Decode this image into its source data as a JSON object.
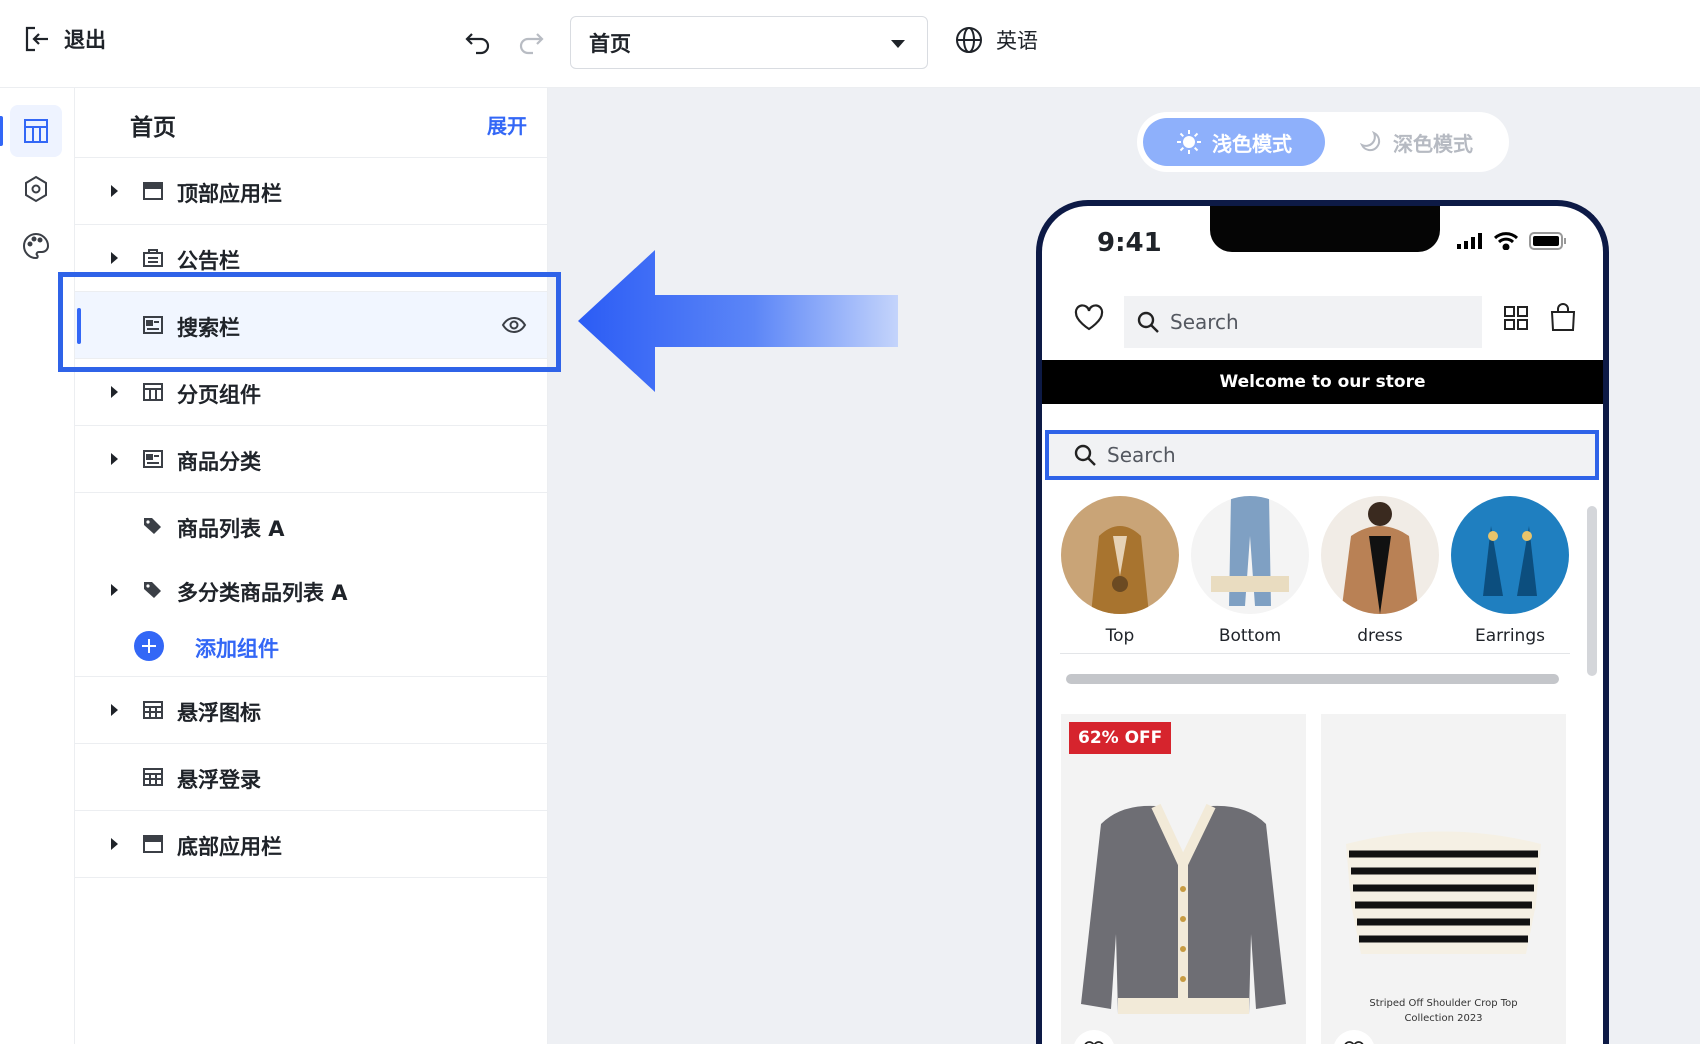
{
  "topbar": {
    "exit_label": "退出",
    "page_select_value": "首页",
    "language_label": "英语"
  },
  "rail": {
    "items": [
      "layout-icon",
      "settings-hex-icon",
      "palette-icon"
    ]
  },
  "tree": {
    "title": "首页",
    "expand_label": "展开",
    "items": [
      {
        "label": "顶部应用栏",
        "icon": "top-bar-icon",
        "expandable": true
      },
      {
        "label": "公告栏",
        "icon": "announcement-icon",
        "expandable": true
      },
      {
        "label": "搜索栏",
        "icon": "search-bar-icon",
        "expandable": false,
        "selected": true
      },
      {
        "label": "分页组件",
        "icon": "pagination-icon",
        "expandable": true
      },
      {
        "label": "商品分类",
        "icon": "category-icon",
        "expandable": true
      },
      {
        "label": "商品列表 A",
        "icon": "tag-icon",
        "expandable": false
      },
      {
        "label": "多分类商品列表 A",
        "icon": "tag-icon",
        "expandable": true
      }
    ],
    "add_component_label": "添加组件",
    "floating_items": [
      {
        "label": "悬浮图标",
        "icon": "float-icon",
        "expandable": true
      },
      {
        "label": "悬浮登录",
        "icon": "float-login-icon",
        "expandable": false
      },
      {
        "label": "底部应用栏",
        "icon": "bottom-bar-icon",
        "expandable": true
      }
    ]
  },
  "mode_toggle": {
    "light_label": "浅色模式",
    "dark_label": "深色模式",
    "active": "light"
  },
  "phone": {
    "status_time": "9:41",
    "header_search_placeholder": "Search",
    "announcement": "Welcome to our store",
    "body_search_placeholder": "Search",
    "categories": [
      "Top",
      "Bottom",
      "dress",
      "Earrings"
    ],
    "products": [
      {
        "badge": "62% OFF",
        "caption": ""
      },
      {
        "badge": "",
        "caption_line1": "Striped Off Shoulder Crop Top",
        "caption_line2": "Collection 2023"
      }
    ]
  },
  "colors": {
    "accent": "#3367f6",
    "highlight_border": "#2f63e8",
    "phone_frame": "#0d1a46",
    "badge_red": "#d6242d"
  }
}
